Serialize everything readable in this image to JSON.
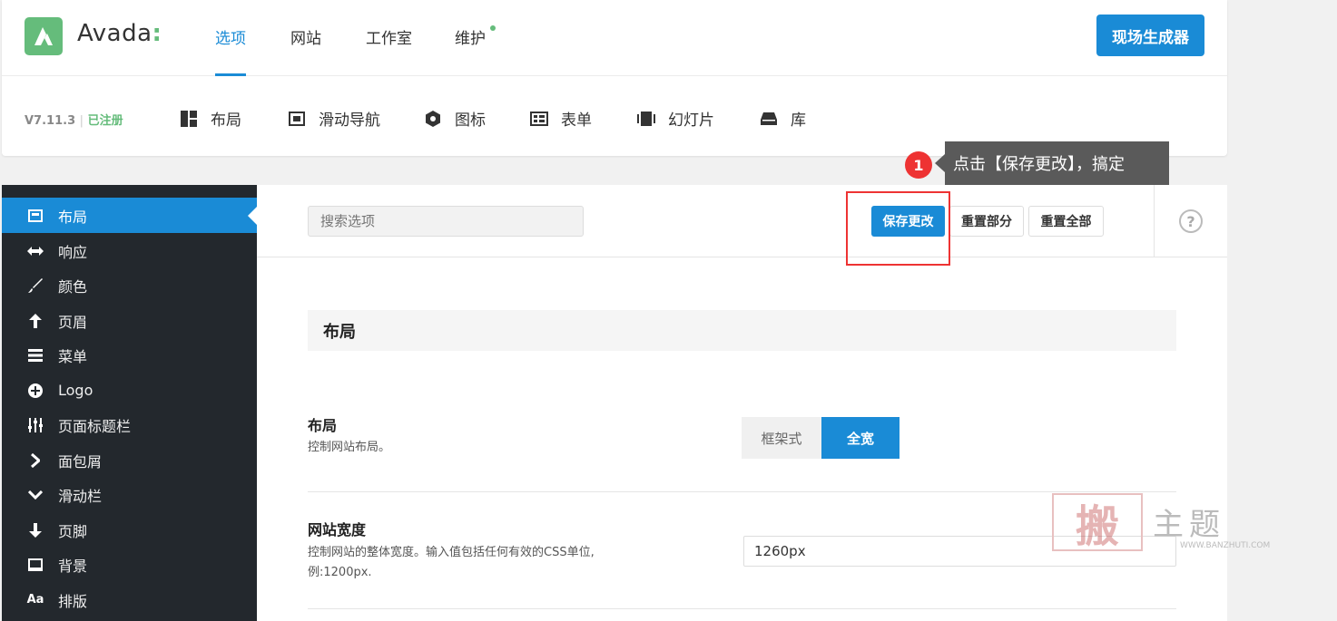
{
  "brand": {
    "name": "Avada",
    "colon": ":",
    "colors": {
      "accent": "#1a8bd6",
      "brand": "#65bc7b",
      "alert": "#ee3333"
    }
  },
  "header": {
    "tabs": [
      {
        "label": "选项"
      },
      {
        "label": "网站"
      },
      {
        "label": "工作室"
      },
      {
        "label": "维护"
      }
    ],
    "builder_button": "现场生成器",
    "version": "V7.11.3",
    "separator": "|",
    "registered": "已注册",
    "sub_nav": [
      {
        "label": "布局",
        "icon": "layout-icon"
      },
      {
        "label": "滑动导航",
        "icon": "slider-nav-icon"
      },
      {
        "label": "图标",
        "icon": "icons-icon"
      },
      {
        "label": "表单",
        "icon": "forms-icon"
      },
      {
        "label": "幻灯片",
        "icon": "slides-icon"
      },
      {
        "label": "库",
        "icon": "library-icon"
      }
    ]
  },
  "annotation": {
    "step": "1",
    "text": "点击【保存更改】，搞定"
  },
  "sidebar": {
    "items": [
      {
        "label": "布局",
        "icon": "layout-icon"
      },
      {
        "label": "响应",
        "icon": "responsive-icon"
      },
      {
        "label": "颜色",
        "icon": "brush-icon"
      },
      {
        "label": "页眉",
        "icon": "arrow-up-icon"
      },
      {
        "label": "菜单",
        "icon": "menu-icon"
      },
      {
        "label": "Logo",
        "icon": "plus-circle-icon"
      },
      {
        "label": "页面标题栏",
        "icon": "sliders-icon"
      },
      {
        "label": "面包屑",
        "icon": "chevron-right-icon"
      },
      {
        "label": "滑动栏",
        "icon": "chevron-down-icon"
      },
      {
        "label": "页脚",
        "icon": "arrow-down-icon"
      },
      {
        "label": "背景",
        "icon": "monitor-icon"
      },
      {
        "label": "排版",
        "icon": "typography-icon"
      }
    ]
  },
  "toolbar": {
    "search_placeholder": "搜索选项",
    "save": "保存更改",
    "reset_section": "重置部分",
    "reset_all": "重置全部",
    "help": "?"
  },
  "content": {
    "section_title": "布局",
    "layout_option": {
      "title": "布局",
      "desc": "控制网站布局。",
      "options": [
        "框架式",
        "全宽"
      ],
      "selected": "全宽"
    },
    "width_option": {
      "title": "网站宽度",
      "desc_line1": "控制网站的整体宽度。输入值包括任何有效的CSS单位,",
      "desc_line2": "例:1200px.",
      "value": "1260px"
    }
  },
  "watermark": {
    "stamp": "搬",
    "text": "主题",
    "url": "WWW.BANZHUTI.COM"
  }
}
